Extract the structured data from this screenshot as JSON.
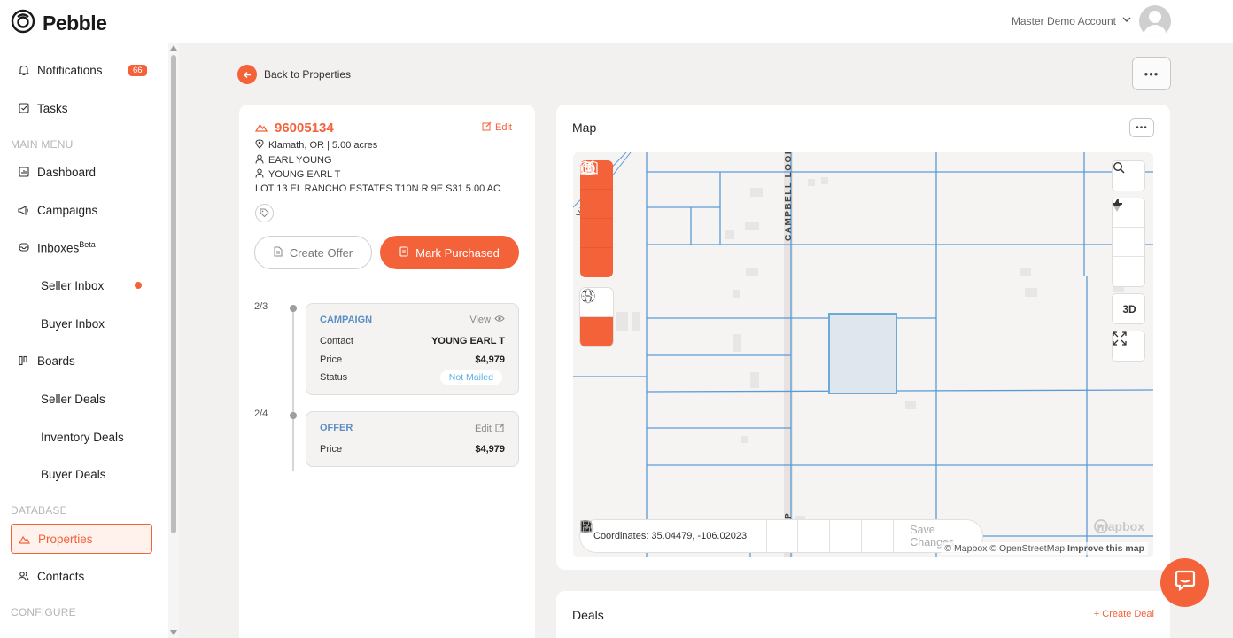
{
  "app": {
    "name": "Pebble",
    "brand_color": "#f4623a"
  },
  "header": {
    "account_label": "Master Demo Account"
  },
  "sidebar": {
    "notifications": {
      "label": "Notifications",
      "count": "66"
    },
    "tasks": "Tasks",
    "sections": {
      "main_menu": "MAIN MENU",
      "database": "DATABASE",
      "configure": "CONFIGURE"
    },
    "items": {
      "dashboard": "Dashboard",
      "campaigns": "Campaigns",
      "inboxes": "Inboxes",
      "inboxes_badge": "Beta",
      "seller_inbox": "Seller Inbox",
      "buyer_inbox": "Buyer Inbox",
      "boards": "Boards",
      "seller_deals": "Seller Deals",
      "inventory_deals": "Inventory Deals",
      "buyer_deals": "Buyer Deals",
      "properties": "Properties",
      "contacts": "Contacts"
    }
  },
  "back_link": "Back to Properties",
  "property": {
    "id": "96005134",
    "edit_label": "Edit",
    "location": "Klamath, OR | 5.00 acres",
    "owner1": "EARL YOUNG",
    "owner2": "YOUNG EARL T",
    "legal": "LOT 13 EL RANCHO ESTATES T10N R 9E S31 5.00 AC",
    "create_offer_label": "Create Offer",
    "mark_purchased_label": "Mark Purchased"
  },
  "timeline": {
    "campaign": {
      "step": "2/3",
      "title": "CAMPAIGN",
      "action": "View",
      "contact_label": "Contact",
      "contact_value": "YOUNG EARL T",
      "price_label": "Price",
      "price_value": "$4,979",
      "status_label": "Status",
      "status_value": "Not Mailed"
    },
    "offer": {
      "step": "2/4",
      "title": "OFFER",
      "action": "Edit",
      "price_label": "Price",
      "price_value": "$4,979"
    }
  },
  "map": {
    "title": "Map",
    "street_vertical": "CAMPBELL LOOP",
    "street_bottom": "LOOP",
    "street_left": "VE",
    "three_d_label": "3D",
    "coordinates": "Coordinates: 35.04479, -106.02023",
    "save_changes_label": "Save Changes",
    "mapbox_label": "mapbox",
    "attribution_mapbox": "© Mapbox",
    "attribution_osm": "© OpenStreetMap",
    "attribution_improve": "Improve this map"
  },
  "deals": {
    "title": "Deals",
    "create_label": "+ Create Deal"
  }
}
